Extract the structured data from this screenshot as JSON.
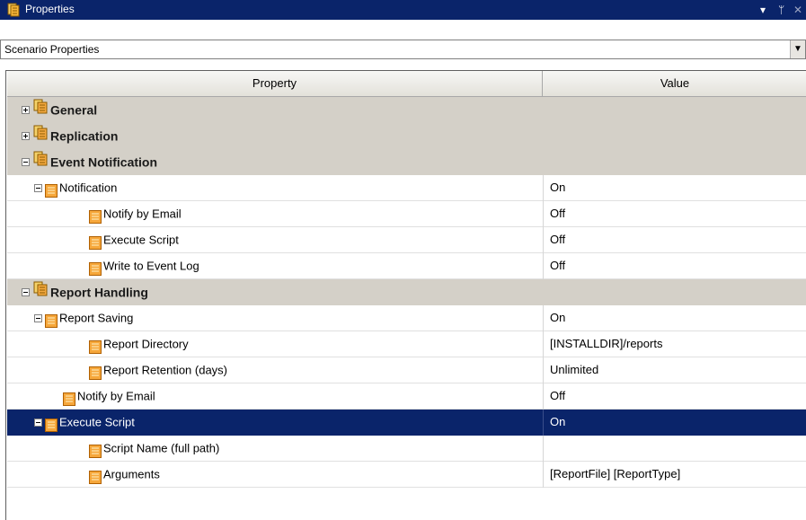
{
  "window": {
    "title": "Properties",
    "controls": [
      "▾",
      "ᛘ",
      "✕"
    ]
  },
  "combo": {
    "selected": "Scenario Properties"
  },
  "grid": {
    "header_property": "Property",
    "header_value": "Value",
    "rows": [
      {
        "label": "General",
        "value": "",
        "type": "group",
        "expander": "+"
      },
      {
        "label": "Replication",
        "value": "",
        "type": "group",
        "expander": "+"
      },
      {
        "label": "Event Notification",
        "value": "",
        "type": "group",
        "expander": "-"
      },
      {
        "label": "Notification",
        "value": "On",
        "type": "item",
        "expander": "-"
      },
      {
        "label": "Notify by Email",
        "value": "Off",
        "type": "item",
        "expander": ""
      },
      {
        "label": "Execute Script",
        "value": "Off",
        "type": "item",
        "expander": ""
      },
      {
        "label": "Write to Event Log",
        "value": "Off",
        "type": "item",
        "expander": ""
      },
      {
        "label": "Report Handling",
        "value": "",
        "type": "group",
        "expander": "-"
      },
      {
        "label": "Report Saving",
        "value": "On",
        "type": "item",
        "expander": "-"
      },
      {
        "label": "Report Directory",
        "value": "[INSTALLDIR]/reports",
        "type": "item",
        "expander": ""
      },
      {
        "label": "Report Retention (days)",
        "value": "Unlimited",
        "type": "item",
        "expander": ""
      },
      {
        "label": "Notify by Email",
        "value": "Off",
        "type": "item",
        "expander": ""
      },
      {
        "label": "Execute Script",
        "value": "On",
        "type": "item",
        "expander": "-",
        "selected": true
      },
      {
        "label": "Script Name (full path)",
        "value": "",
        "type": "item",
        "expander": ""
      },
      {
        "label": "Arguments",
        "value": "[ReportFile] [ReportType]",
        "type": "item",
        "expander": ""
      }
    ]
  },
  "colors": {
    "titlebar": "#0a246a",
    "selection": "#0a246a",
    "group_row": "#d4d0c8",
    "item_icon": "#f2a23a"
  },
  "icons": {
    "group": "stacked-pages-icon",
    "item": "property-list-icon"
  }
}
